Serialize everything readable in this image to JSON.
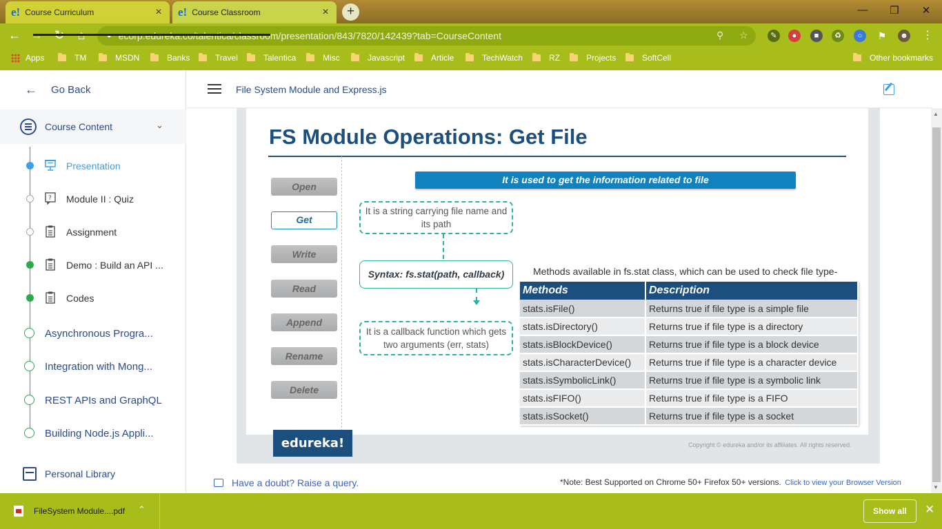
{
  "browser": {
    "tabs": [
      {
        "favicon": "e!",
        "title": "Course Curriculum",
        "close": "×"
      },
      {
        "favicon": "e!",
        "title": "Course Classroom",
        "close": "×"
      }
    ],
    "new_tab": "+",
    "url": "ecorp.edureka.co/talentica/classroom/presentation/843/7820/142439?tab=CourseContent",
    "bookmarks": [
      "Apps",
      "TM",
      "MSDN",
      "Banks",
      "Travel",
      "Talentica",
      "Misc",
      "Javascript",
      "Article",
      "TechWatch",
      "RZ",
      "Projects",
      "SoftCell"
    ],
    "other_bookmarks": "Other bookmarks"
  },
  "sidebar": {
    "go_back": "Go Back",
    "course_content": "Course Content",
    "items": [
      {
        "label": "Presentation",
        "icon": "presentation-icon"
      },
      {
        "label": "Module II : Quiz",
        "icon": "quiz-icon"
      },
      {
        "label": "Assignment",
        "icon": "clipboard-icon"
      },
      {
        "label": "Demo : Build an API ...",
        "icon": "clipboard-icon"
      },
      {
        "label": "Codes",
        "icon": "clipboard-icon"
      }
    ],
    "modules": [
      "Asynchronous Progra...",
      "Integration with Mong...",
      "REST APIs and GraphQL",
      "Building Node.js Appli..."
    ],
    "personal_library": "Personal Library"
  },
  "main": {
    "title": "File System Module and Express.js"
  },
  "slide": {
    "title": "FS Module Operations: Get File",
    "operations": [
      "Open",
      "Get",
      "Write",
      "Read",
      "Append",
      "Rename",
      "Delete"
    ],
    "selected_operation": "Get",
    "banner": "It is used to get the information related to file",
    "note_top": "It is a string carrying file name and its path",
    "syntax": "Syntax: fs.stat(path, callback)",
    "note_bottom": "It is a callback function which gets two arguments (err, stats)",
    "methods_caption": "Methods available in fs.stat class, which can be used to check file type-",
    "table_headers": [
      "Methods",
      "Description"
    ],
    "table_rows": [
      [
        "stats.isFile()",
        "Returns true if file type is a simple file"
      ],
      [
        "stats.isDirectory()",
        "Returns true if file type is a directory"
      ],
      [
        "stats.isBlockDevice()",
        "Returns true if file type is a block device"
      ],
      [
        "stats.isCharacterDevice()",
        "Returns true if file type is a character device"
      ],
      [
        "stats.isSymbolicLink()",
        "Returns true if file type is a symbolic link"
      ],
      [
        "stats.isFIFO()",
        "Returns true if file type is a FIFO"
      ],
      [
        "stats.isSocket()",
        "Returns true if file type is a socket"
      ]
    ],
    "logo": "edureka!",
    "copyright": "Copyright © edureka and/or its affiliates. All rights reserved."
  },
  "footer": {
    "doubt": "Have a doubt? Raise a query.",
    "note": "*Note: Best Supported on Chrome 50+ Firefox 50+ versions.",
    "note_link": "Click to view your Browser Version"
  },
  "downloads": {
    "file": "FileSystem Module....pdf",
    "show_all": "Show all"
  },
  "colors": {
    "accent": "#2a4a8a",
    "active": "#3aa0e8",
    "completed": "#2aaa48",
    "slide_blue": "#1d4f7e",
    "chrome_green": "#a8bd1c"
  }
}
